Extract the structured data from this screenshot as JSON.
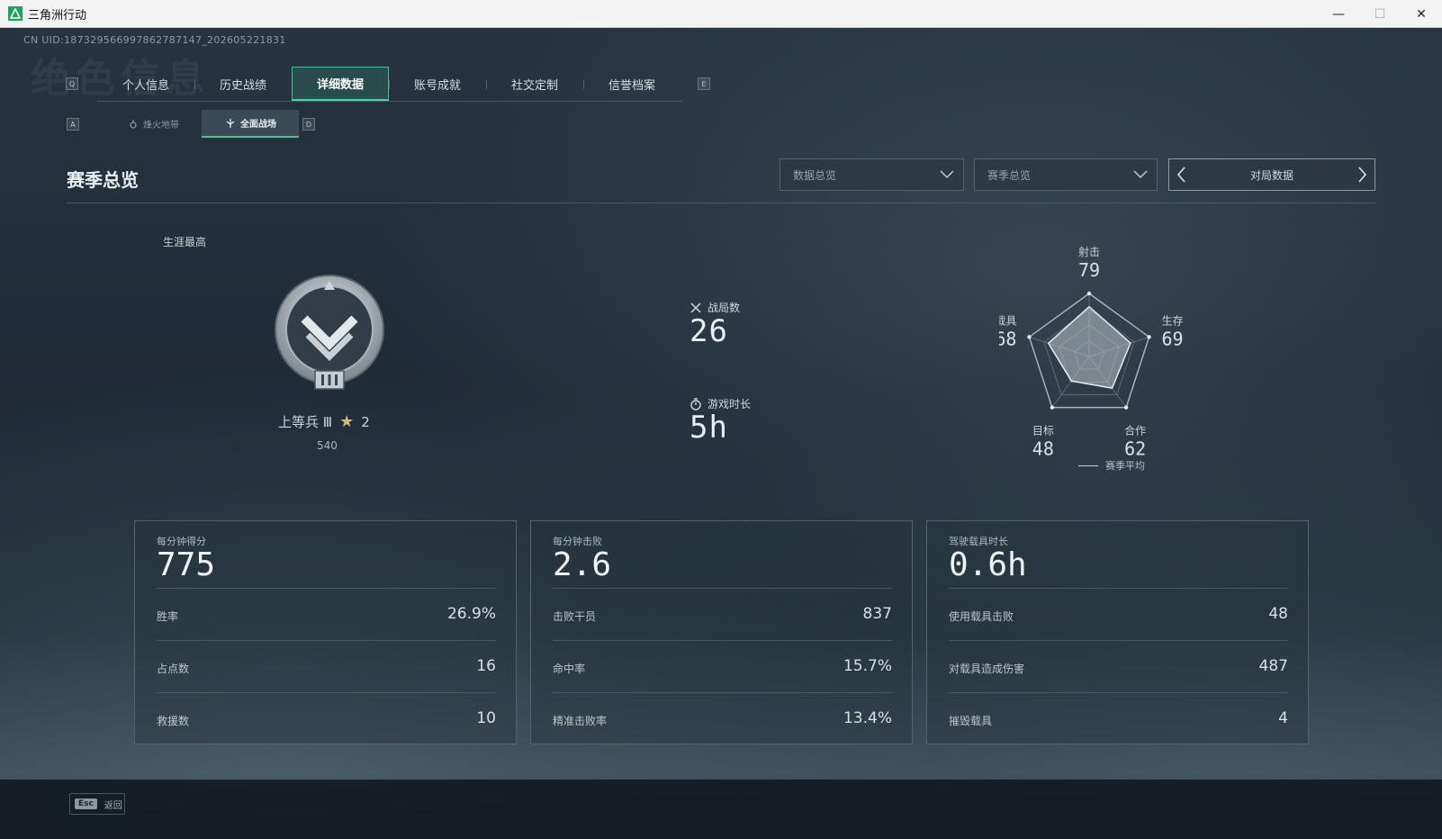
{
  "window": {
    "title": "三角洲行动",
    "minimize": "—",
    "maximize": "☐",
    "close": "✕"
  },
  "uid": "CN UID:187329566997862787147_202605221831",
  "watermark": "绝色信息",
  "key_hints": {
    "tab_left": "Q",
    "tab_right": "E",
    "sub_left": "A",
    "sub_right": "D"
  },
  "tabs": [
    {
      "label": "个人信息",
      "active": false
    },
    {
      "label": "历史战绩",
      "active": false
    },
    {
      "label": "详细数据",
      "active": true
    },
    {
      "label": "账号成就",
      "active": false
    },
    {
      "label": "社交定制",
      "active": false
    },
    {
      "label": "信誉档案",
      "active": false
    }
  ],
  "subtabs": [
    {
      "label": "烽火地带",
      "active": false
    },
    {
      "label": "全面战场",
      "active": true
    }
  ],
  "section_title": "赛季总览",
  "filters": {
    "data_overview": "数据总览",
    "season_overview": "赛季总览",
    "pager_label": "对局数据"
  },
  "career": {
    "label": "生涯最高",
    "rank_name": "上等兵 Ⅲ",
    "stars": "2",
    "score": "540"
  },
  "stats": {
    "battles_label": "战局数",
    "battles_value": "26",
    "playtime_label": "游戏时长",
    "playtime_value": "5h"
  },
  "radar": {
    "axes": [
      {
        "label": "射击",
        "value": 79
      },
      {
        "label": "生存",
        "value": 69
      },
      {
        "label": "合作",
        "value": 62
      },
      {
        "label": "目标",
        "value": 48
      },
      {
        "label": "载具",
        "value": 68
      }
    ],
    "legend": "赛季平均"
  },
  "cards": [
    {
      "top_label": "每分钟得分",
      "top_value": "775",
      "rows": [
        {
          "k": "胜率",
          "v": "26.9%"
        },
        {
          "k": "占点数",
          "v": "16"
        },
        {
          "k": "救援数",
          "v": "10"
        }
      ]
    },
    {
      "top_label": "每分钟击败",
      "top_value": "2.6",
      "rows": [
        {
          "k": "击败干员",
          "v": "837"
        },
        {
          "k": "命中率",
          "v": "15.7%"
        },
        {
          "k": "精准击败率",
          "v": "13.4%"
        }
      ]
    },
    {
      "top_label": "驾驶载具时长",
      "top_value": "0.6h",
      "rows": [
        {
          "k": "使用载具击败",
          "v": "48"
        },
        {
          "k": "对载具造成伤害",
          "v": "487"
        },
        {
          "k": "摧毁载具",
          "v": "4"
        }
      ]
    }
  ],
  "footer": {
    "esc_key": "Esc",
    "back_label": "返回"
  }
}
